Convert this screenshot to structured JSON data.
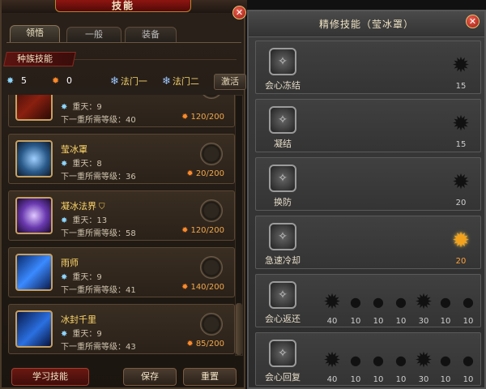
{
  "window": {
    "title": "技能",
    "close": "✕"
  },
  "tabs": [
    {
      "label": "领悟",
      "active": true
    },
    {
      "label": "一般",
      "active": false
    },
    {
      "label": "装备",
      "active": false
    }
  ],
  "race_section": {
    "label": "种族技能"
  },
  "points": {
    "blue_points": "5",
    "fire_points": "0",
    "school_one": "法门一",
    "school_two": "法门二",
    "activate": "激活"
  },
  "skills": [
    {
      "name": "",
      "stat_label": "重天：9",
      "requirement": "下一重所需等级：40",
      "cost": "120/200",
      "icon": "slash-icon"
    },
    {
      "name": "莹冰罩",
      "stat_label": "重天：8",
      "requirement": "下一重所需等级：36",
      "cost": "20/200",
      "icon": "ice-shield-icon"
    },
    {
      "name": "凝冰法界",
      "stat_label": "重天：13",
      "requirement": "下一重所需等级：58",
      "cost": "120/200",
      "icon": "ice-domain-icon"
    },
    {
      "name": "雨师",
      "stat_label": "重天：9",
      "requirement": "下一重所需等级：41",
      "cost": "140/200",
      "icon": "rain-icon"
    },
    {
      "name": "冰封千里",
      "stat_label": "重天：9",
      "requirement": "下一重所需等级：43",
      "cost": "85/200",
      "icon": "frost-icon"
    }
  ],
  "bottom_buttons": {
    "learn": "学习技能",
    "save": "保存",
    "reset": "重置"
  },
  "refine_panel": {
    "title": "精修技能（莹冰罩）",
    "close": "✕",
    "rows": [
      {
        "name": "会心冻结",
        "nodes": [
          {
            "value": "15",
            "lit": false
          }
        ]
      },
      {
        "name": "凝结",
        "nodes": [
          {
            "value": "15",
            "lit": false
          }
        ]
      },
      {
        "name": "换防",
        "nodes": [
          {
            "value": "20",
            "lit": false
          }
        ]
      },
      {
        "name": "急速冷却",
        "nodes": [
          {
            "value": "20",
            "lit": true
          }
        ]
      },
      {
        "name": "会心返还",
        "nodes": [
          {
            "value": "40",
            "lit": false
          },
          {
            "value": "10",
            "lit": false
          },
          {
            "value": "10",
            "lit": false
          },
          {
            "value": "10",
            "lit": false
          },
          {
            "value": "30",
            "lit": false
          },
          {
            "value": "10",
            "lit": false
          },
          {
            "value": "10",
            "lit": false
          }
        ]
      },
      {
        "name": "会心回复",
        "nodes": [
          {
            "value": "40",
            "lit": false
          },
          {
            "value": "10",
            "lit": false
          },
          {
            "value": "10",
            "lit": false
          },
          {
            "value": "10",
            "lit": false
          },
          {
            "value": "30",
            "lit": false
          },
          {
            "value": "10",
            "lit": false
          },
          {
            "value": "10",
            "lit": false
          }
        ]
      }
    ]
  }
}
